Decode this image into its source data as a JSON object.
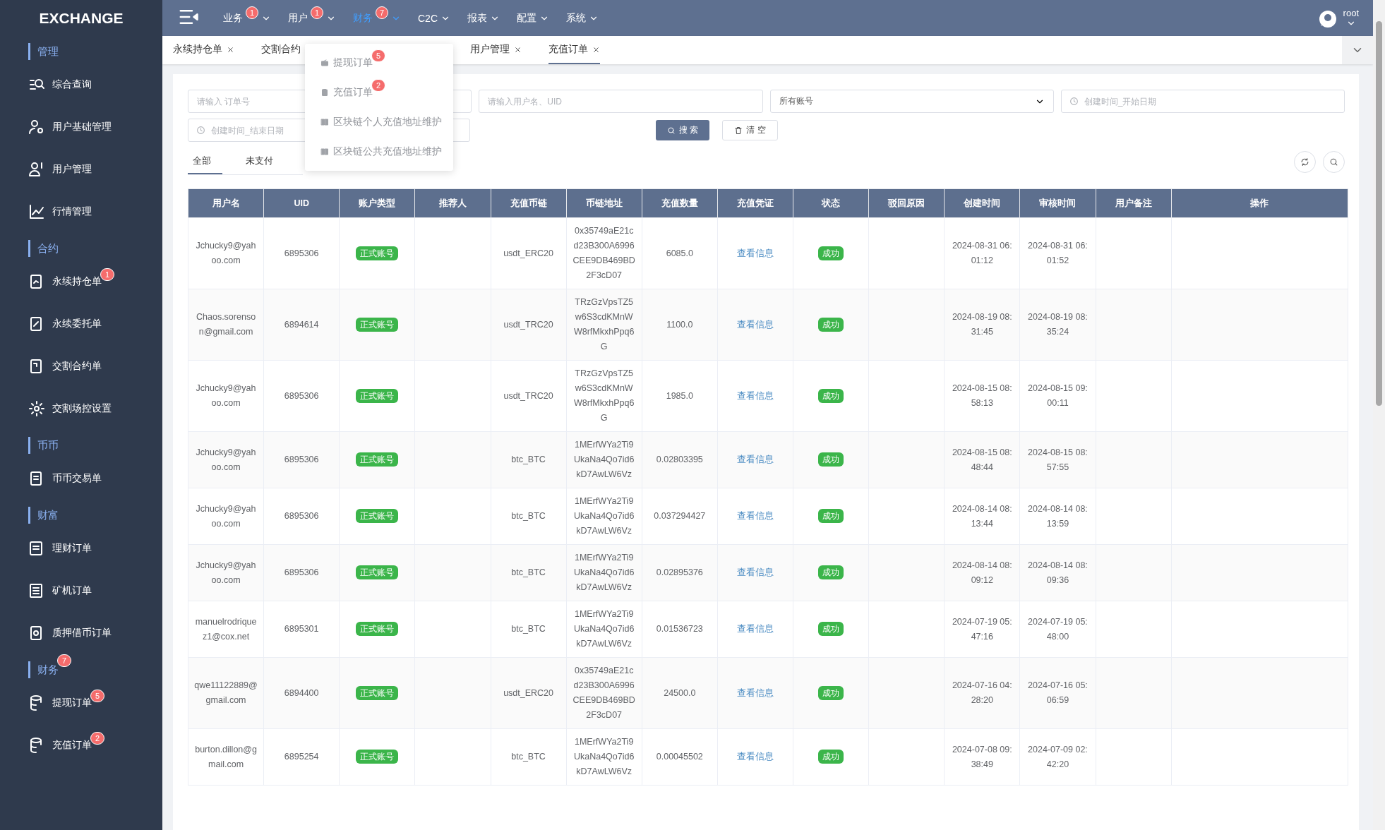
{
  "sidebar": {
    "logo": "EXCHANGE",
    "groups": [
      {
        "title": "管理",
        "items": [
          {
            "label": "综合查询"
          },
          {
            "label": "用户基础管理"
          },
          {
            "label": "用户管理"
          },
          {
            "label": "行情管理"
          }
        ]
      },
      {
        "title": "合约",
        "items": [
          {
            "label": "永续持仓单",
            "badge": "1"
          },
          {
            "label": "永续委托单"
          },
          {
            "label": "交割合约单"
          },
          {
            "label": "交割场控设置"
          }
        ]
      },
      {
        "title": "币币",
        "items": [
          {
            "label": "币币交易单"
          }
        ]
      },
      {
        "title": "财富",
        "items": [
          {
            "label": "理财订单"
          },
          {
            "label": "矿机订单"
          },
          {
            "label": "质押借币订单"
          }
        ]
      },
      {
        "title": "财务",
        "badge": "7",
        "items": [
          {
            "label": "提现订单",
            "badge": "5"
          },
          {
            "label": "充值订单",
            "badge": "2"
          }
        ]
      }
    ]
  },
  "topbar": {
    "menu": [
      {
        "label": "业务",
        "badge": "1",
        "selected": false
      },
      {
        "label": "用户",
        "badge": "1",
        "selected": false
      },
      {
        "label": "财务",
        "badge": "7",
        "selected": true
      },
      {
        "label": "C2C",
        "selected": false
      },
      {
        "label": "报表",
        "selected": false
      },
      {
        "label": "配置",
        "selected": false
      },
      {
        "label": "系统",
        "selected": false
      }
    ],
    "user": "root"
  },
  "tabs": [
    {
      "label": "永续持仓单",
      "selected": false,
      "closable": true
    },
    {
      "label": "交割合约",
      "selected": false,
      "closable": false
    },
    {
      "label": "用户管理",
      "selected": false,
      "closable": true
    },
    {
      "label": "充值订单",
      "selected": true,
      "closable": true
    }
  ],
  "dropdown": {
    "items": [
      {
        "label": "提现订单",
        "badge": "5"
      },
      {
        "label": "充值订单",
        "badge": "2"
      },
      {
        "label": "区块链个人充值地址维护"
      },
      {
        "label": "区块链公共充值地址维护"
      }
    ]
  },
  "filters": {
    "order_no": {
      "placeholder": "请输入 订单号"
    },
    "user": {
      "placeholder": "请输入用户名、UID"
    },
    "account": {
      "value": "所有账号"
    },
    "start_date": {
      "placeholder": "创建时间_开始日期"
    },
    "end_date": {
      "placeholder": "创建时间_结束日期"
    },
    "search_button": "搜 索",
    "clear_button": "清 空"
  },
  "status_tabs": [
    {
      "label": "全部",
      "selected": true
    },
    {
      "label": "未支付",
      "selected": false
    }
  ],
  "table": {
    "columns": [
      "用户名",
      "UID",
      "账户类型",
      "推荐人",
      "充值币链",
      "币链地址",
      "充值数量",
      "充值凭证",
      "状态",
      "驳回原因",
      "创建时间",
      "审核时间",
      "用户备注",
      "操作"
    ],
    "rows": [
      {
        "username": "Jchucky9@yahoo.com",
        "uid": "6895306",
        "account_type": "正式账号",
        "chain": "usdt_ERC20",
        "address": "0x35749aE21cd23B300A6996CEE9DB469BD2F3cD07",
        "amount": "6085.0",
        "voucher": "查看信息",
        "status": "成功",
        "created": "2024-08-31 06:01:12",
        "reviewed": "2024-08-31 06:01:52"
      },
      {
        "username": "Chaos.sorenson@gmail.com",
        "uid": "6894614",
        "account_type": "正式账号",
        "chain": "usdt_TRC20",
        "address": "TRzGzVpsTZ5w6S3cdKMnWW8rfMkxhPpq6G",
        "amount": "1100.0",
        "voucher": "查看信息",
        "status": "成功",
        "created": "2024-08-19 08:31:45",
        "reviewed": "2024-08-19 08:35:24"
      },
      {
        "username": "Jchucky9@yahoo.com",
        "uid": "6895306",
        "account_type": "正式账号",
        "chain": "usdt_TRC20",
        "address": "TRzGzVpsTZ5w6S3cdKMnWW8rfMkxhPpq6G",
        "amount": "1985.0",
        "voucher": "查看信息",
        "status": "成功",
        "created": "2024-08-15 08:58:13",
        "reviewed": "2024-08-15 09:00:11"
      },
      {
        "username": "Jchucky9@yahoo.com",
        "uid": "6895306",
        "account_type": "正式账号",
        "chain": "btc_BTC",
        "address": "1MErfWYa2Ti9UkaNa4Qo7id6kD7AwLW6Vz",
        "amount": "0.02803395",
        "voucher": "查看信息",
        "status": "成功",
        "created": "2024-08-15 08:48:44",
        "reviewed": "2024-08-15 08:57:55"
      },
      {
        "username": "Jchucky9@yahoo.com",
        "uid": "6895306",
        "account_type": "正式账号",
        "chain": "btc_BTC",
        "address": "1MErfWYa2Ti9UkaNa4Qo7id6kD7AwLW6Vz",
        "amount": "0.037294427",
        "voucher": "查看信息",
        "status": "成功",
        "created": "2024-08-14 08:13:44",
        "reviewed": "2024-08-14 08:13:59"
      },
      {
        "username": "Jchucky9@yahoo.com",
        "uid": "6895306",
        "account_type": "正式账号",
        "chain": "btc_BTC",
        "address": "1MErfWYa2Ti9UkaNa4Qo7id6kD7AwLW6Vz",
        "amount": "0.02895376",
        "voucher": "查看信息",
        "status": "成功",
        "created": "2024-08-14 08:09:12",
        "reviewed": "2024-08-14 08:09:36"
      },
      {
        "username": "manuelrodriquez1@cox.net",
        "uid": "6895301",
        "account_type": "正式账号",
        "chain": "btc_BTC",
        "address": "1MErfWYa2Ti9UkaNa4Qo7id6kD7AwLW6Vz",
        "amount": "0.01536723",
        "voucher": "查看信息",
        "status": "成功",
        "created": "2024-07-19 05:47:16",
        "reviewed": "2024-07-19 05:48:00"
      },
      {
        "username": "qwe11122889@gmail.com",
        "uid": "6894400",
        "account_type": "正式账号",
        "chain": "usdt_ERC20",
        "address": "0x35749aE21cd23B300A6996CEE9DB469BD2F3cD07",
        "amount": "24500.0",
        "voucher": "查看信息",
        "status": "成功",
        "created": "2024-07-16 04:28:20",
        "reviewed": "2024-07-16 05:06:59"
      },
      {
        "username": "burton.dillon@gmail.com",
        "uid": "6895254",
        "account_type": "正式账号",
        "chain": "btc_BTC",
        "address": "1MErfWYa2Ti9UkaNa4Qo7id6kD7AwLW6Vz",
        "amount": "0.00045502",
        "voucher": "查看信息",
        "status": "成功",
        "created": "2024-07-08 09:38:49",
        "reviewed": "2024-07-09 02:42:20"
      }
    ]
  }
}
